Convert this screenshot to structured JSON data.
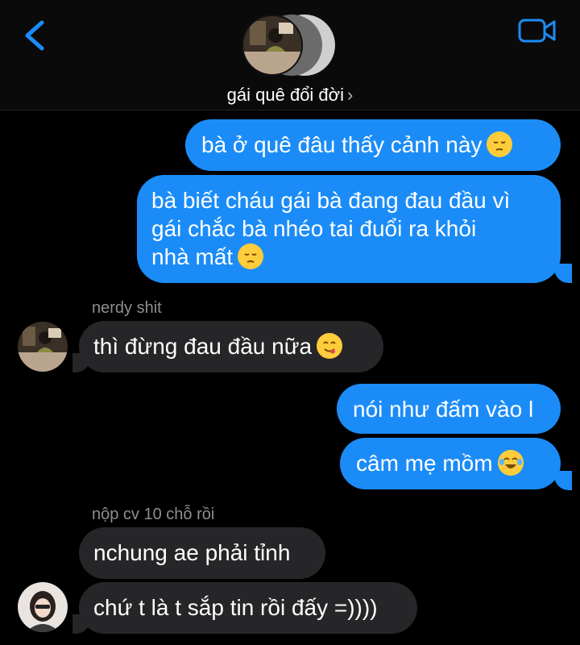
{
  "header": {
    "title": "gái quê đổi đời",
    "title_chevron": "›",
    "back_icon": "chevron-left-icon",
    "video_icon": "video-camera-icon",
    "accent_color": "#1b8cf7"
  },
  "messages": [
    {
      "direction": "outgoing",
      "text": "bà ở quê đâu thấy cảnh này",
      "emoji": "pensive-face"
    },
    {
      "direction": "outgoing",
      "lines": [
        "bà biết cháu gái bà đang đau đầu vì",
        "gái chắc bà nhéo tai đuổi ra khỏi",
        "nhà mất"
      ],
      "emoji": "pensive-face"
    },
    {
      "direction": "incoming",
      "sender": "nerdy shit",
      "text": "thì đừng đau đầu nữa",
      "emoji": "face-savoring-food"
    },
    {
      "direction": "outgoing",
      "text": "nói như đấm vào l"
    },
    {
      "direction": "outgoing",
      "text": "câm mẹ mồm",
      "emoji": "face-with-tears-of-joy"
    },
    {
      "direction": "incoming",
      "sender": "nộp cv 10 chỗ rồi",
      "text": "nchung ae phải tỉnh"
    },
    {
      "direction": "incoming",
      "text": "chứ t là t sắp tin rồi đấy =))))"
    }
  ],
  "colors": {
    "outgoing_bubble": "#1b8cf7",
    "incoming_bubble": "#262629",
    "background": "#000000",
    "sender_label": "#8e8e93"
  }
}
